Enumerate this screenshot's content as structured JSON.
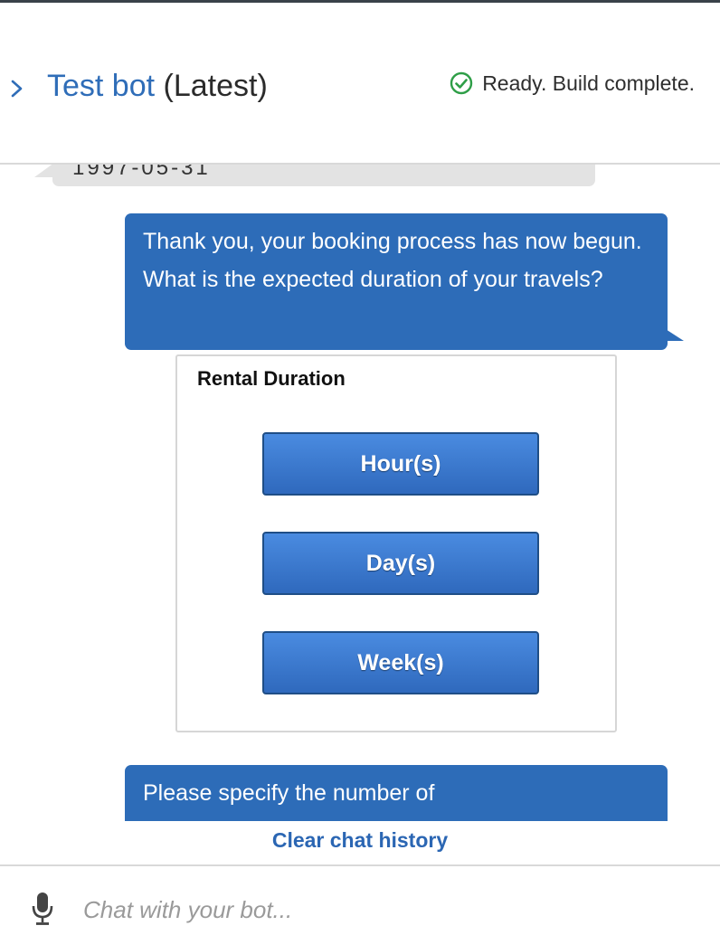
{
  "header": {
    "title_name": "Test bot",
    "title_version": "(Latest)",
    "status_text": "Ready. Build complete.",
    "status_color": "#2e9e47",
    "accent_color": "#2f6db8"
  },
  "chat": {
    "previous_message_fragment": "1997-05-31",
    "messages": [
      {
        "from": "bot",
        "text": "Thank you, your booking process has now begun. What is the expected duration of your travels?"
      },
      {
        "from": "bot",
        "text": "Please specify the number of"
      }
    ],
    "response_card": {
      "title": "Rental Duration",
      "options": [
        {
          "label": "Hour(s)"
        },
        {
          "label": "Day(s)"
        },
        {
          "label": "Week(s)"
        }
      ]
    },
    "bubble_color": "#2d6cb8"
  },
  "footer": {
    "clear_label": "Clear chat history",
    "input_placeholder": "Chat with your bot...",
    "input_value": ""
  },
  "icons": {
    "expand": "chevron-right-icon",
    "status": "check-circle-icon",
    "voice": "microphone-icon"
  }
}
